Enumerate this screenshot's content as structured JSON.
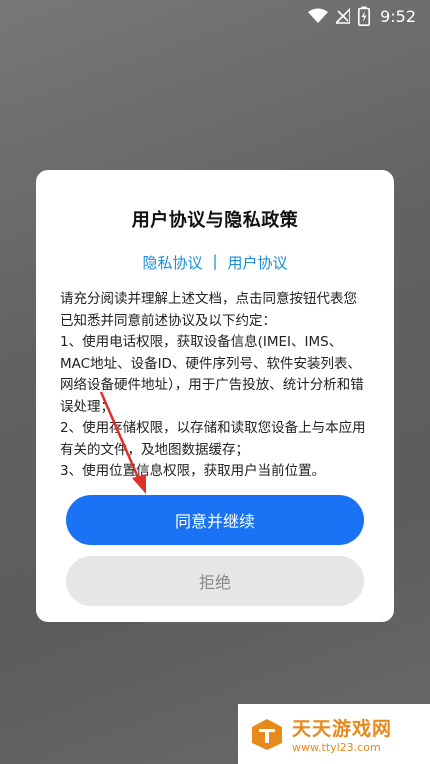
{
  "status_bar": {
    "time": "9:52",
    "icons": [
      "wifi-icon",
      "signal-icon",
      "battery-charging-icon"
    ]
  },
  "dialog": {
    "title": "用户协议与隐私政策",
    "links": {
      "privacy": "隐私协议",
      "separator": "|",
      "user": "用户协议"
    },
    "body": "请充分阅读并理解上述文档，点击同意按钮代表您已知悉并同意前述协议及以下约定：\n1、使用电话权限，获取设备信息(IMEI、IMS、MAC地址、设备ID、硬件序列号、软件安装列表、网络设备硬件地址），用于广告投放、统计分析和错误处理；\n2、使用存储权限，以存储和读取您设备上与本应用有关的文件，及地图数据缓存；\n3、使用位置信息权限，获取用户当前位置。",
    "agree_label": "同意并继续",
    "reject_label": "拒绝"
  },
  "watermark": {
    "name": "天天游戏网",
    "url": "www.ttyl23.com"
  },
  "colors": {
    "primary": "#1a73f5",
    "link": "#1a8fd8",
    "annotation_arrow": "#e0302a",
    "watermark": "#e8891b"
  }
}
